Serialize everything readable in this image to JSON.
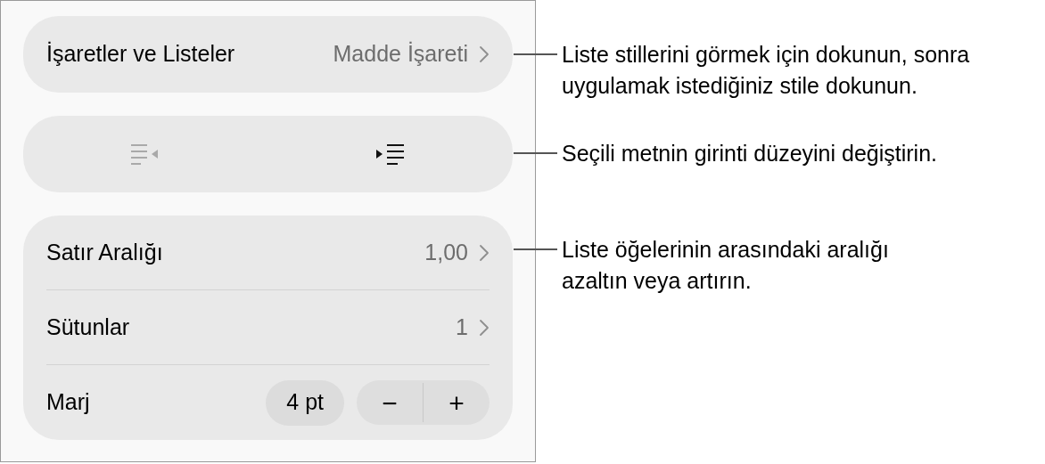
{
  "list_row": {
    "label": "İşaretler ve Listeler",
    "value": "Madde İşareti"
  },
  "indent_buttons": [
    {
      "kind": "outdent",
      "disabled": true
    },
    {
      "kind": "indent",
      "disabled": false
    }
  ],
  "settings_rows": [
    {
      "kind": "nav",
      "label": "Satır Aralığı",
      "value": "1,00"
    },
    {
      "kind": "nav",
      "label": "Sütunlar",
      "value": "1"
    },
    {
      "kind": "stepper",
      "label": "Marj",
      "value": "4 pt",
      "minus": "−",
      "plus": "+"
    }
  ],
  "callouts": [
    {
      "text": "Liste stillerini görmek için dokunun, sonra uygulamak istediğiniz stile dokunun."
    },
    {
      "text": "Seçili metnin girinti düzeyini değiştirin."
    },
    {
      "text": "Liste öğelerinin arasındaki aralığı azaltın veya artırın."
    }
  ]
}
